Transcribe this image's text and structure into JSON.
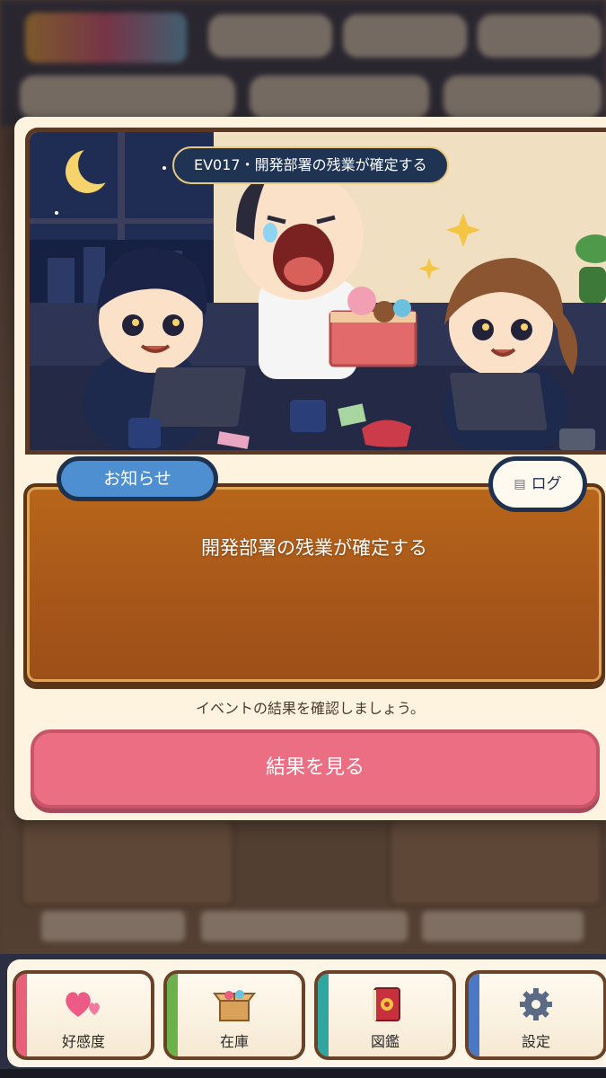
{
  "modal": {
    "event_title": "EV017・開発部署の残業が確定する",
    "notice_tab_label": "お知らせ",
    "log_button_label": "ログ",
    "log_icon": "list-icon",
    "message": "開発部署の残業が確定する",
    "hint": "イベントの結果を確認しましょう。",
    "result_button_label": "結果を見る"
  },
  "bottom_nav": {
    "items": [
      {
        "label": "好感度",
        "icon": "hearts-icon",
        "accent": "#e8607a"
      },
      {
        "label": "在庫",
        "icon": "box-icon",
        "accent": "#6cb24a"
      },
      {
        "label": "図鑑",
        "icon": "book-icon",
        "accent": "#2fa6a0"
      },
      {
        "label": "設定",
        "icon": "gear-icon",
        "accent": "#4a78c4"
      }
    ]
  },
  "colors": {
    "result_button": "#ec6e83",
    "message_box": "#a8571a",
    "notice_tab": "#4d8fd1",
    "navy": "#1e3250"
  }
}
